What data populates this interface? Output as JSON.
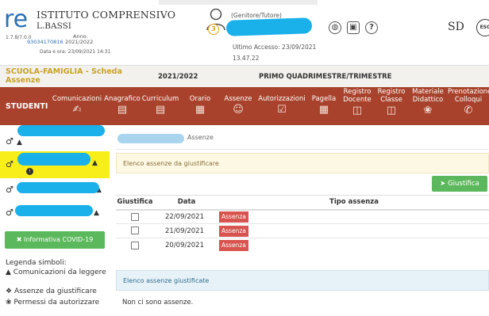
{
  "header": {
    "school_name": "ISTITUTO COMPRENSIVO",
    "school_city": "L.BASSI",
    "version": "1.7.8/7.0.0",
    "code": "93034170816",
    "anno_label": "Anno:",
    "anno_value": "2021/2022",
    "datetime": "Data e ora: 23/09/2021 14:31",
    "role": "(Genitore/Tutore)",
    "badge_count": "3",
    "last_access": "Ultimo Accesso: 23/09/2021",
    "last_access_time": "13.47.22",
    "help_icon": "?",
    "brand_logo": "SD",
    "esc_logo": "ESC"
  },
  "title_row": {
    "title": "SCUOLA-FAMIGLIA - Scheda Assenze",
    "year": "2021/2022",
    "period": "PRIMO QUADRIMESTRE/TRIMESTRE"
  },
  "menu": {
    "studenti": "STUDENTI",
    "items": [
      {
        "label": "Comunicazioni",
        "icon": "hand-pen-icon"
      },
      {
        "label": "Anagrafico",
        "icon": "document-icon"
      },
      {
        "label": "Curriculum",
        "icon": "document-list-icon"
      },
      {
        "label": "Orario",
        "icon": "timetable-icon"
      },
      {
        "label": "Assenze",
        "icon": "face-icon"
      },
      {
        "label": "Autorizzazioni",
        "icon": "calendar-check-icon"
      },
      {
        "label": "Pagella",
        "icon": "report-card-icon"
      },
      {
        "label": "Registro Docente",
        "icon": "book-icon"
      },
      {
        "label": "Registro Classe",
        "icon": "class-book-icon"
      },
      {
        "label": "Materiale Didattico",
        "icon": "material-icon"
      },
      {
        "label": "Prenotazione Colloqui",
        "icon": "chat-icon"
      }
    ]
  },
  "sidebar": {
    "covid_button": "Informativa COVID-19",
    "legend_title": "Legenda simboli:",
    "legend": [
      {
        "icon": "megaphone-icon",
        "text": "Comunicazioni da leggere"
      },
      {
        "icon": "alert-dot-icon",
        "text": "Assenze da giustificare"
      },
      {
        "icon": "paw-icon",
        "text": "Permessi da autorizzare"
      }
    ]
  },
  "main": {
    "breadcrumb": "Assenze",
    "to_justify_title": "Elenco assenze da giustificare",
    "justify_button": "Giustifica",
    "table": {
      "headers": [
        "Giustifica",
        "Data",
        "Tipo assenza"
      ],
      "rows": [
        {
          "date": "22/09/2021",
          "type": "Assenza"
        },
        {
          "date": "21/09/2021",
          "type": "Assenza"
        },
        {
          "date": "20/09/2021",
          "type": "Assenza"
        }
      ]
    },
    "justified_title": "Elenco assenze giustificate",
    "no_absences": "Non ci sono assenze."
  },
  "colors": {
    "menu_bar": "#a8422c",
    "title_gold": "#c9a227",
    "selected_student": "#f8ef1a",
    "success_green": "#5cb85c",
    "absence_red": "#d9534f",
    "redaction_blue": "#1ab0ea"
  }
}
